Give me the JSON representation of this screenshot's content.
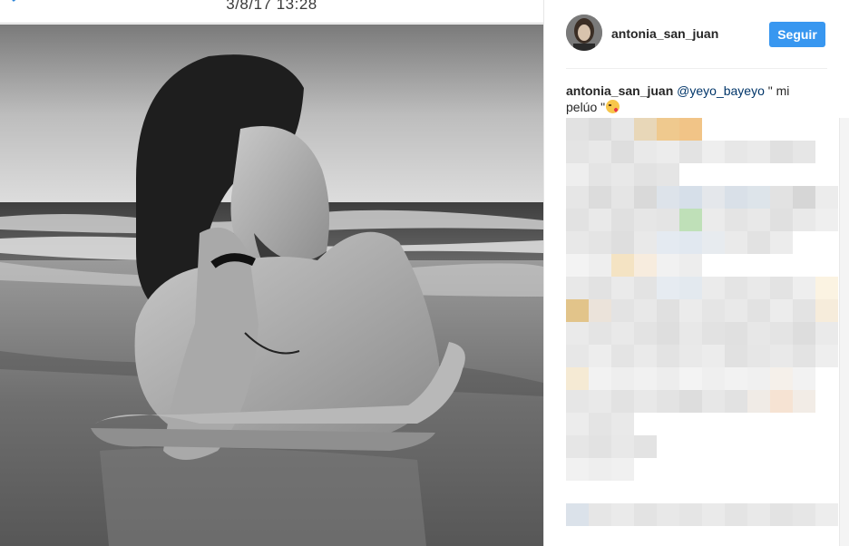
{
  "window": {
    "timestamp": "3/8/17 13:28"
  },
  "post": {
    "image_icon": "photo-beach-man"
  },
  "header": {
    "username": "antonia_san_juan",
    "follow_label": "Seguir",
    "follow_color": "#3897f0"
  },
  "caption": {
    "author": "antonia_san_juan",
    "mention": "@yeyo_bayeyo",
    "text": " \" mi pelúo \"",
    "emoji": "kissing-face-heart-emoji"
  },
  "comments": {
    "state": "pixelated"
  }
}
